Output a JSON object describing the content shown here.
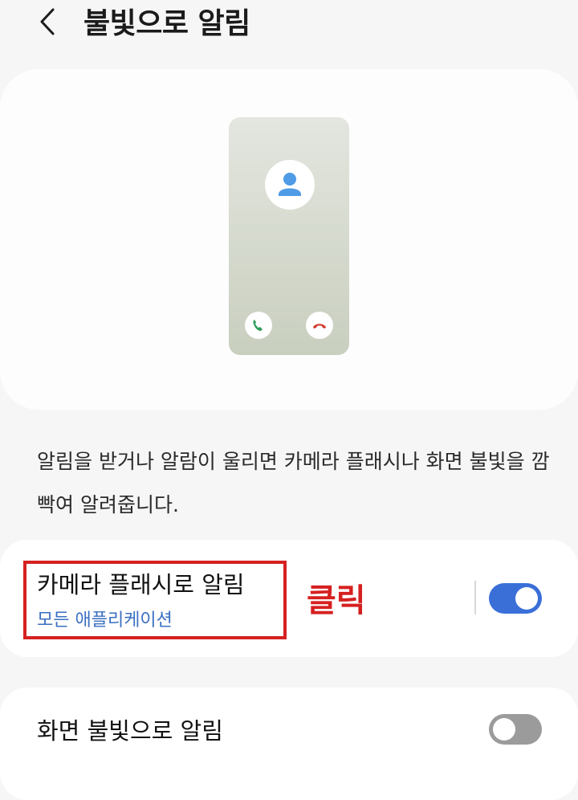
{
  "header": {
    "title": "불빛으로 알림",
    "back_icon": "chevron-left-icon"
  },
  "preview": {
    "avatar_icon": "person-icon",
    "accept_icon": "phone-accept-icon",
    "decline_icon": "phone-decline-icon",
    "colors": {
      "avatar": "#4f9be6",
      "accept": "#2f9d5b",
      "decline": "#d33a2e"
    }
  },
  "description": "알림을 받거나 알람이 울리면 카메라 플래시나 화면 불빛을 깜빡여 알려줍니다.",
  "settings": [
    {
      "title": "카메라 플래시로 알림",
      "subtitle": "모든 애플리케이션",
      "enabled": true
    },
    {
      "title": "화면 불빛으로 알림",
      "enabled": false
    }
  ],
  "annotation": {
    "label": "클릭",
    "color": "#d62020"
  },
  "colors": {
    "accent": "#3a6fd8",
    "link": "#3a6fc2",
    "toggle_off": "#9b9b9b"
  }
}
